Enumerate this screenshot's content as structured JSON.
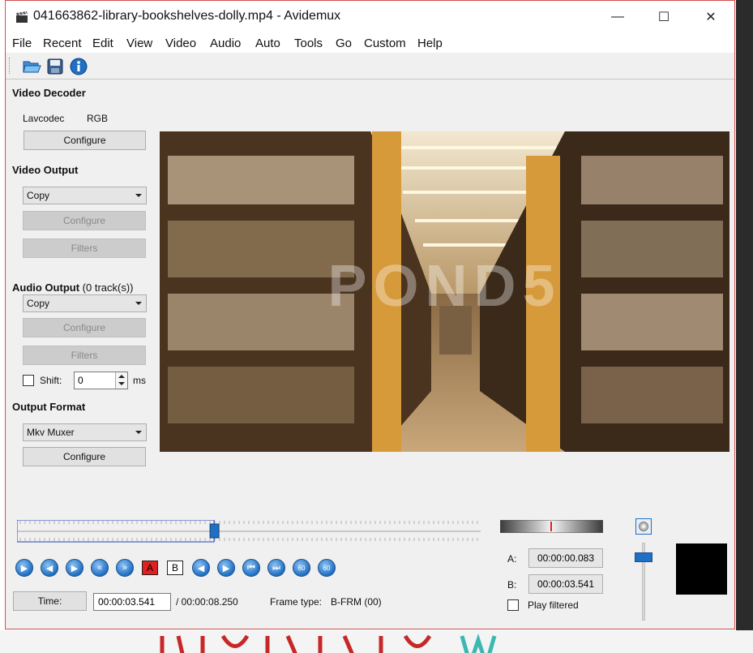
{
  "window": {
    "title": "041663862-library-bookshelves-dolly.mp4 - Avidemux",
    "minimize_glyph": "—",
    "maximize_glyph": "☐",
    "close_glyph": "✕"
  },
  "menu": [
    "File",
    "Recent",
    "Edit",
    "View",
    "Video",
    "Audio",
    "Auto",
    "Tools",
    "Go",
    "Custom",
    "Help"
  ],
  "toolbar": {
    "icons": [
      "open-folder-icon",
      "save-disk-icon",
      "info-icon"
    ]
  },
  "video_decoder": {
    "title": "Video Decoder",
    "codec": "Lavcodec",
    "colorspace": "RGB",
    "configure_label": "Configure"
  },
  "video_output": {
    "title": "Video Output",
    "selected": "Copy",
    "configure_label": "Configure",
    "filters_label": "Filters"
  },
  "audio_output": {
    "title": "Audio Output",
    "tracks": "(0 track(s))",
    "selected": "Copy",
    "configure_label": "Configure",
    "filters_label": "Filters",
    "shift_label": "Shift:",
    "shift_value": "0",
    "shift_unit": "ms"
  },
  "output_format": {
    "title": "Output Format",
    "selected": "Mkv Muxer",
    "configure_label": "Configure"
  },
  "video_preview": {
    "watermark": "POND5"
  },
  "playback": {
    "position_fraction": 0.425,
    "selection_end_fraction": 0.425,
    "marker_a_label": "A",
    "marker_b_label": "B",
    "goto_frame_labels": [
      "60",
      "60"
    ]
  },
  "status": {
    "time_button": "Time:",
    "current_time": "00:00:03.541",
    "total_time": "/ 00:00:08.250",
    "frame_type_label": "Frame type:",
    "frame_type_value": "B-FRM (00)"
  },
  "markers": {
    "a_label": "A:",
    "a_value": "00:00:00.083",
    "b_label": "B:",
    "b_value": "00:00:03.541",
    "play_filtered_label": "Play filtered"
  },
  "colors": {
    "accent": "#1f6fc4",
    "window_border": "#d05050",
    "marker_red": "#e02020"
  }
}
